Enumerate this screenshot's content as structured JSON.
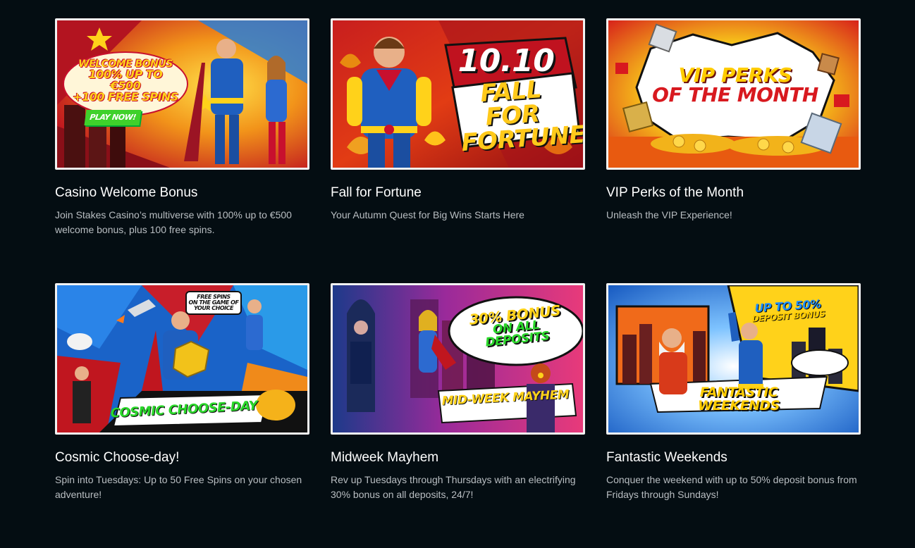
{
  "promotions": [
    {
      "title": "Casino Welcome Bonus",
      "description": "Join Stakes Casino’s multiverse with 100% up to €500 welcome bonus, plus 100 free spins.",
      "banner": {
        "line1": "WELCOME BONUS",
        "line2": "100% UP TO €500",
        "line3": "+100 FREE SPINS",
        "cta": "PLAY NOW!"
      }
    },
    {
      "title": "Fall for Fortune",
      "description": "Your Autumn Quest for Big Wins Starts Here",
      "banner": {
        "date": "10.10",
        "line1": "FALL FOR",
        "line2": "FORTUNE"
      }
    },
    {
      "title": "VIP Perks of the Month",
      "description": "Unleash the VIP Experience!",
      "banner": {
        "line1": "VIP PERKS",
        "line2": "OF THE MONTH"
      }
    },
    {
      "title": "Cosmic Choose-day!",
      "description": "Spin into Tuesdays: Up to 50 Free Spins on your chosen adventure!",
      "banner": {
        "bubble1": "FREE SPINS",
        "bubble2": "ON THE GAME OF YOUR CHOICE",
        "main": "COSMIC CHOOSE-DAY"
      }
    },
    {
      "title": "Midweek Mayhem",
      "description": "Rev up Tuesdays through Thursdays with an electrifying 30% bonus on all deposits, 24/7!",
      "banner": {
        "line1": "30% BONUS",
        "line2": "ON ALL DEPOSITS",
        "main": "MID-WEEK MAYHEM"
      }
    },
    {
      "title": "Fantastic Weekends",
      "description": "Conquer the weekend with up to 50% deposit bonus from Fridays through Sundays!",
      "banner": {
        "line1": "UP TO 50%",
        "line2": "DEPOSIT BONUS",
        "main": "FANTASTIC WEEKENDS"
      }
    }
  ],
  "colors": {
    "page_background": "#040d12",
    "title": "#ffffff",
    "description": "#b9bec2",
    "banner_border": "#f2f2f2"
  }
}
